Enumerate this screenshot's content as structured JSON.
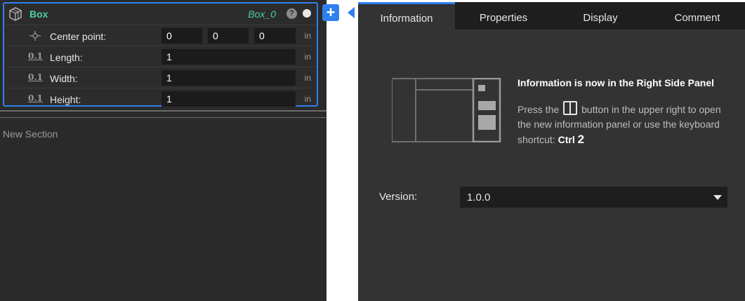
{
  "feature": {
    "title": "Box",
    "instance_name": "Box_0",
    "help_label": "?",
    "add_label": "+",
    "params": {
      "center": {
        "icon": "center-point-icon",
        "label": "Center point:",
        "x": "0",
        "y": "0",
        "z": "0",
        "unit": "in"
      },
      "length": {
        "icon": "0.1",
        "label": "Length:",
        "value": "1",
        "unit": "in"
      },
      "width": {
        "icon": "0.1",
        "label": "Width:",
        "value": "1",
        "unit": "in"
      },
      "height": {
        "icon": "0.1",
        "label": "Height:",
        "value": "1",
        "unit": "in"
      }
    }
  },
  "left": {
    "new_section_label": "New Section"
  },
  "tabs": [
    {
      "label": "Information"
    },
    {
      "label": "Properties"
    },
    {
      "label": "Display"
    },
    {
      "label": "Comment"
    }
  ],
  "info": {
    "heading": "Information is now in the Right Side Panel",
    "text_press": "Press the",
    "text_rest": "button in the upper right to open the new information panel or use the keyboard shortcut:",
    "shortcut_key": "Ctrl",
    "shortcut_num": "2"
  },
  "version": {
    "label": "Version:",
    "value": "1.0.0"
  },
  "colors": {
    "accent": "#2f80ed",
    "feature_green": "#4cd1a0",
    "panel_bg": "#333333",
    "tab_bar_bg": "#1e1e1e"
  }
}
